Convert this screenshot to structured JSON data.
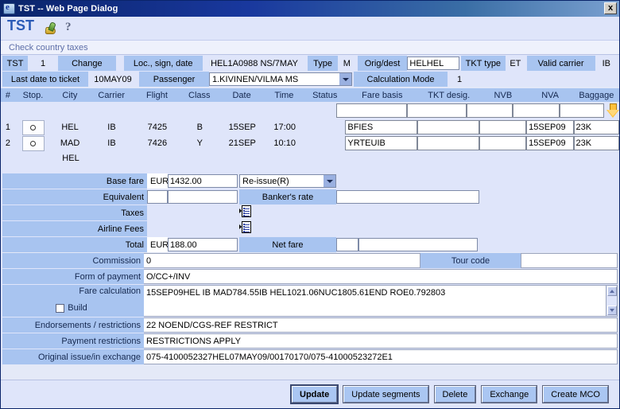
{
  "window": {
    "title": "TST -- Web Page Dialog",
    "close_label": "x",
    "icon": "ie-document-icon"
  },
  "page": {
    "heading": "TST",
    "icons": [
      "money-bag-icon",
      "help-question-icon"
    ],
    "subbar_text": "Check country taxes"
  },
  "header_fields": {
    "tst_label": "TST",
    "tst_value": "1",
    "change_label": "Change",
    "loc_label": "Loc., sign, date",
    "loc_value": "HEL1A0988 NS/7MAY",
    "type_label": "Type",
    "type_value": "M",
    "origdest_label": "Orig/dest",
    "origdest_value": "HELHEL",
    "tkttype_label": "TKT type",
    "tkttype_value": "ET",
    "validcarrier_label": "Valid carrier",
    "validcarrier_value": "IB",
    "lastdate_label": "Last date to ticket",
    "lastdate_value": "10MAY09",
    "passenger_label": "Passenger",
    "passenger_value": "1.KIVINEN/VILMA MS",
    "calcmode_label": "Calculation Mode",
    "calcmode_value": "1"
  },
  "segments": {
    "columns": [
      "#",
      "Stop.",
      "City",
      "Carrier",
      "Flight",
      "Class",
      "Date",
      "Time",
      "Status",
      "Fare basis",
      "TKT desig.",
      "NVB",
      "NVA",
      "Baggage"
    ],
    "blank_row": {
      "fare_basis": "",
      "tkt_desig": "",
      "nvb": "",
      "nva": "",
      "baggage": "",
      "arrow_icon": "orange-down-arrow-icon"
    },
    "rows": [
      {
        "num": "1",
        "stop": "",
        "city": "HEL",
        "carrier": "IB",
        "flight": "7425",
        "class": "B",
        "date": "15SEP",
        "time": "17:00",
        "status": "",
        "fare_basis": "BFIES",
        "tkt_desig": "",
        "nvb": "",
        "nva": "15SEP09",
        "baggage": "23K"
      },
      {
        "num": "2",
        "stop": "",
        "city": "MAD",
        "carrier": "IB",
        "flight": "7426",
        "class": "Y",
        "date": "21SEP",
        "time": "10:10",
        "status": "",
        "fare_basis": "YRTEUIB",
        "tkt_desig": "",
        "nvb": "",
        "nva": "15SEP09",
        "baggage": "23K"
      }
    ],
    "final_city": "HEL"
  },
  "fare": {
    "base_label": "Base fare",
    "base_currency": "EUR",
    "base_value": "1432.00",
    "reissue_value": "Re-issue(R)",
    "equivalent_label": "Equivalent",
    "equivalent_currency": "",
    "equivalent_value": "",
    "bankers_rate_label": "Banker's rate",
    "bankers_rate_value": "",
    "taxes_label": "Taxes",
    "taxes_currency": "",
    "taxes_value": "",
    "taxes_icon": "list-detail-icon",
    "fees_label": "Airline Fees",
    "fees_currency": "",
    "fees_value": "",
    "fees_icon": "list-detail-icon",
    "total_label": "Total",
    "total_currency": "EUR",
    "total_value": "188.00",
    "netfare_label": "Net fare",
    "netfare_currency": "",
    "netfare_value": ""
  },
  "lower": {
    "commission_label": "Commission",
    "commission_value": "0",
    "tourcode_label": "Tour code",
    "tourcode_value": "",
    "fop_label": "Form of payment",
    "fop_value": "O/CC+/INV",
    "farecalc_label": "Fare calculation",
    "farecalc_value": "15SEP09HEL IB MAD784.55IB HEL1021.06NUC1805.61END ROE0.792803",
    "build_label": "Build",
    "endorsements_label": "Endorsements / restrictions",
    "endorsements_value": "22 NOEND/CGS-REF RESTRICT",
    "paymentrestrictions_label": "Payment restrictions",
    "paymentrestrictions_value": "RESTRICTIONS APPLY",
    "originalissue_label": "Original issue/in exchange",
    "originalissue_value": "075-4100052327HEL07MAY09/00170170/075-41000523272E1"
  },
  "footer": {
    "update": "Update",
    "update_segments": "Update segments",
    "delete": "Delete",
    "exchange": "Exchange",
    "create_mco": "Create MCO"
  },
  "colors": {
    "label_blue": "#a8c4f0",
    "panel_blue": "#dfe5fa",
    "title_blue": "#0a246a",
    "heading_text": "#2b5bb7",
    "accent_orange": "#ffc13b"
  }
}
